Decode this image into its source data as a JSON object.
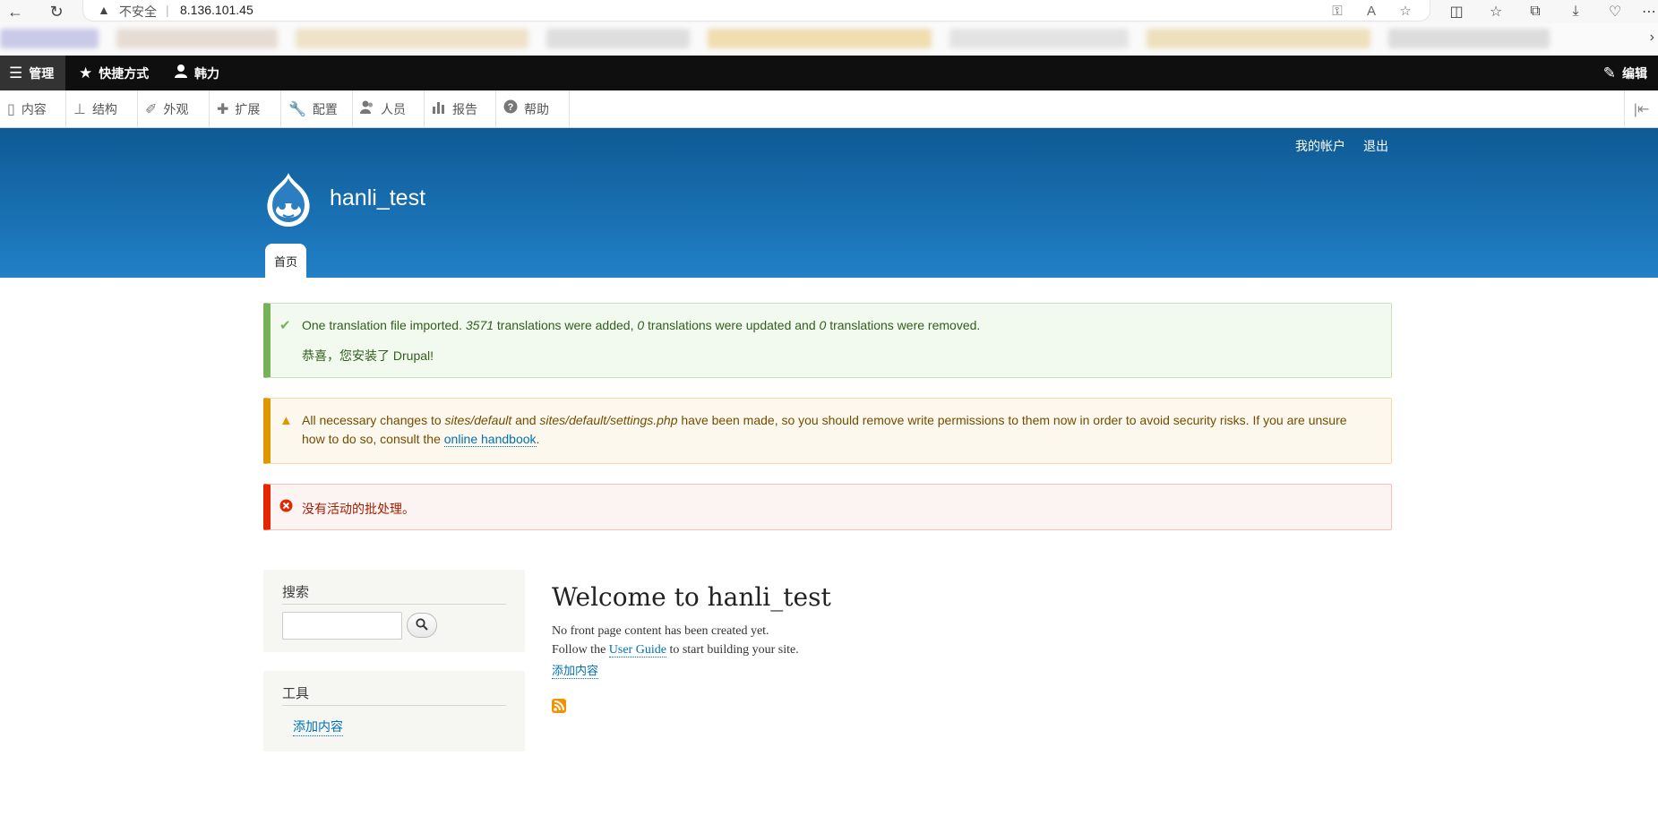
{
  "browser": {
    "security_label": "不安全",
    "url": "8.136.101.45"
  },
  "toolbar": {
    "manage": "管理",
    "shortcuts": "快捷方式",
    "user": "韩力",
    "edit": "编辑"
  },
  "tray": {
    "items": [
      {
        "label": "内容",
        "icon": "file-icon"
      },
      {
        "label": "结构",
        "icon": "sitemap-icon"
      },
      {
        "label": "外观",
        "icon": "paintbrush-icon"
      },
      {
        "label": "扩展",
        "icon": "puzzle-icon"
      },
      {
        "label": "配置",
        "icon": "wrench-icon"
      },
      {
        "label": "人员",
        "icon": "people-icon"
      },
      {
        "label": "报告",
        "icon": "bar-chart-icon"
      },
      {
        "label": "帮助",
        "icon": "help-icon"
      }
    ]
  },
  "header": {
    "my_account": "我的帐户",
    "logout": "退出",
    "site_name": "hanli_test",
    "home_tab": "首页"
  },
  "messages": {
    "status": {
      "p1_a": "One translation file imported. ",
      "p1_n1": "3571",
      "p1_b": " translations were added, ",
      "p1_n2": "0",
      "p1_c": " translations were updated and ",
      "p1_n3": "0",
      "p1_d": " translations were removed.",
      "line2": "恭喜，您安装了 Drupal!"
    },
    "warning": {
      "a": "All necessary changes to ",
      "path1": "sites/default",
      "b": " and ",
      "path2": "sites/default/settings.php",
      "c": " have been made, so you should remove write permissions to them now in order to avoid security risks. If you are unsure",
      "d": "how to do so, consult the ",
      "link": "online handbook",
      "e": "."
    },
    "error": {
      "text": "没有活动的批处理。"
    }
  },
  "sidebar": {
    "search_title": "搜索",
    "tools_title": "工具",
    "tools_link": "添加内容"
  },
  "main": {
    "title": "Welcome to hanli_test",
    "line1": "No front page content has been created yet.",
    "line2_a": "Follow the ",
    "line2_link": "User Guide",
    "line2_b": " to start building your site.",
    "add_content": "添加内容"
  },
  "colors": {
    "header_top": "#0e5a94",
    "header_bottom": "#2180c7",
    "status_border": "#77b259",
    "warning_border": "#e09600",
    "error_border": "#e62600",
    "link": "#0071b3"
  }
}
